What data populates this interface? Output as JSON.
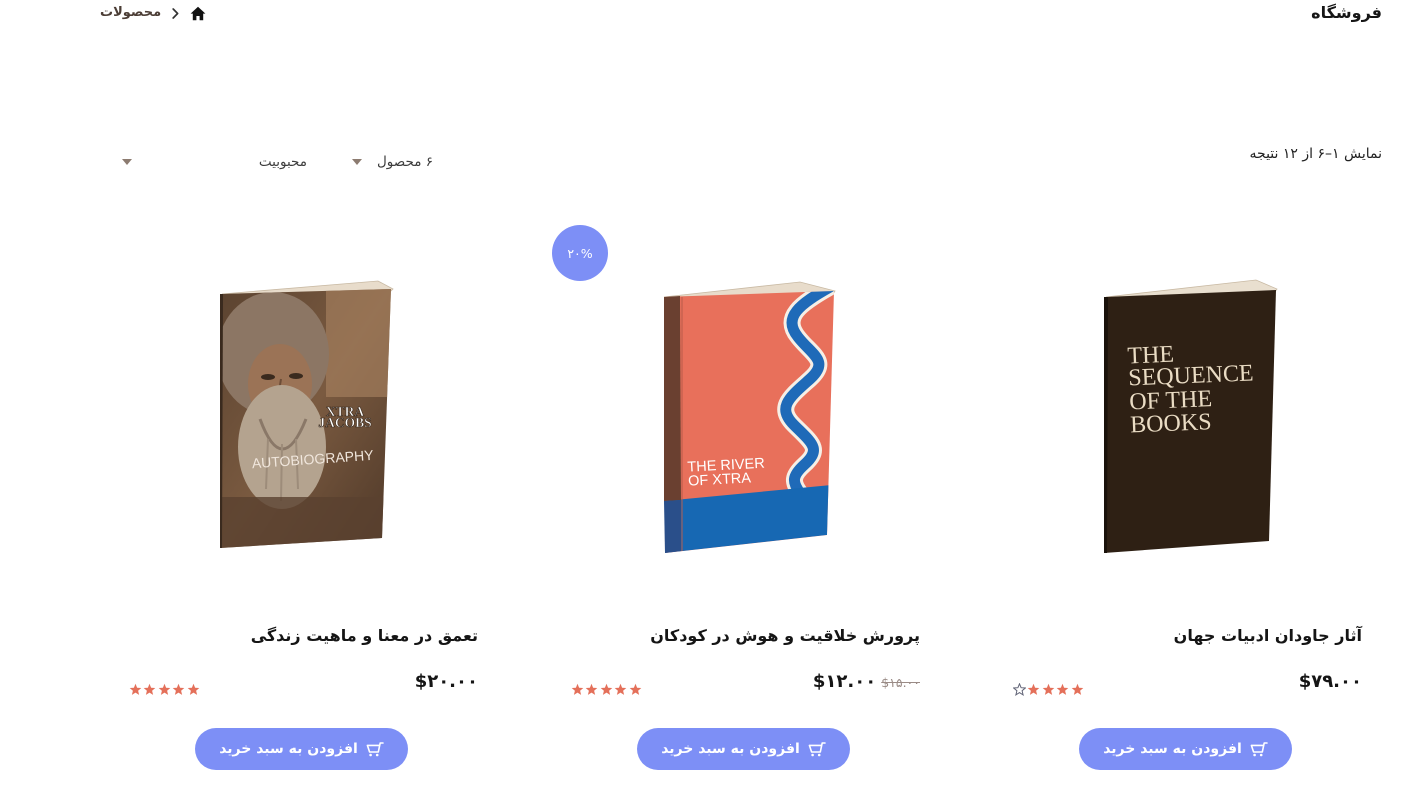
{
  "header": {
    "title": "فروشگاه",
    "breadcrumb": {
      "current": "محصولات"
    }
  },
  "toolbar": {
    "result_count": "نمایش ۱–۶ از ۱۲ نتیجه",
    "per_page_selected": "۶ محصول",
    "orderby_selected": "محبوبیت"
  },
  "products": [
    {
      "title": "آثار جاودان ادبیات جهان",
      "price": "$۷۹.۰۰",
      "rating": 4,
      "rating_max": 5,
      "add_to_cart_label": "افزودن به سبد خرید",
      "cover_text": [
        "THE",
        "SEQUENCE",
        "OF THE",
        "BOOKS"
      ]
    },
    {
      "title": "پرورش خلاقیت و هوش در کودکان",
      "price": "$۱۲.۰۰",
      "regular_price": "$۱۵.۰۰",
      "sale_badge": "۲۰%",
      "rating": 5,
      "rating_max": 5,
      "add_to_cart_label": "افزودن به سبد خرید",
      "cover_text": [
        "THE RIVER",
        "OF XTRA"
      ]
    },
    {
      "title": "تعمق در معنا و ماهیت زندگی",
      "price": "$۲۰.۰۰",
      "rating": 5,
      "rating_max": 5,
      "add_to_cart_label": "افزودن به سبد خرید",
      "cover_text": [
        "XTRA",
        "JACOBS",
        "AUTOBIOGRAPHY"
      ]
    }
  ],
  "icons": {
    "home": "home-icon",
    "breadcrumb_separator": "chevron-right-icon",
    "select_caret": "caret-down-icon",
    "cart": "cart-icon",
    "star": "star-icon"
  },
  "colors": {
    "accent": "#7d8ff6",
    "star": "#e4705a",
    "text": "#1c1c1c",
    "breadcrumb_text": "#4b3d35",
    "old_price": "#9a8b86",
    "caret": "#8c7b70"
  }
}
